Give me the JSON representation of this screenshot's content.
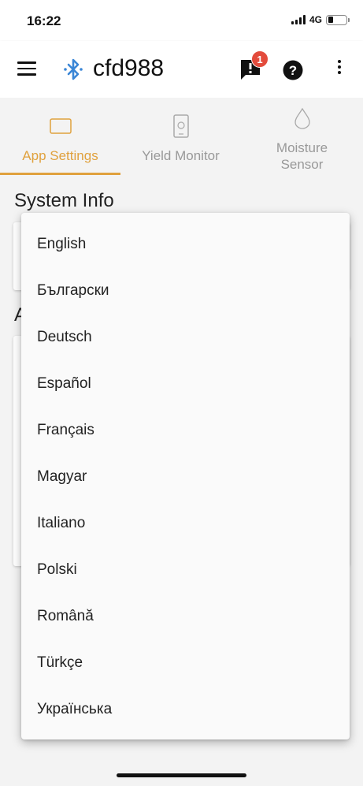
{
  "status_bar": {
    "time": "16:22",
    "network": "4G"
  },
  "app_bar": {
    "device_name": "cfd988",
    "alert_count": "1"
  },
  "tabs": [
    {
      "label": "App Settings",
      "icon": "tablet-icon",
      "active": true
    },
    {
      "label": "Yield Monitor",
      "icon": "phone-device-icon",
      "active": false
    },
    {
      "label": "Moisture Sensor",
      "icon": "droplet-icon",
      "active": false
    }
  ],
  "page": {
    "section_title": "System Info",
    "partial_section_letter": "A"
  },
  "language_menu": {
    "options": [
      "English",
      "Български",
      "Deutsch",
      "Español",
      "Français",
      "Magyar",
      "Italiano",
      "Polski",
      "Română",
      "Türkçe",
      "Українська"
    ]
  },
  "colors": {
    "accent": "#e0a13d",
    "badge": "#e34b3c",
    "bluetooth": "#3a86d6"
  }
}
